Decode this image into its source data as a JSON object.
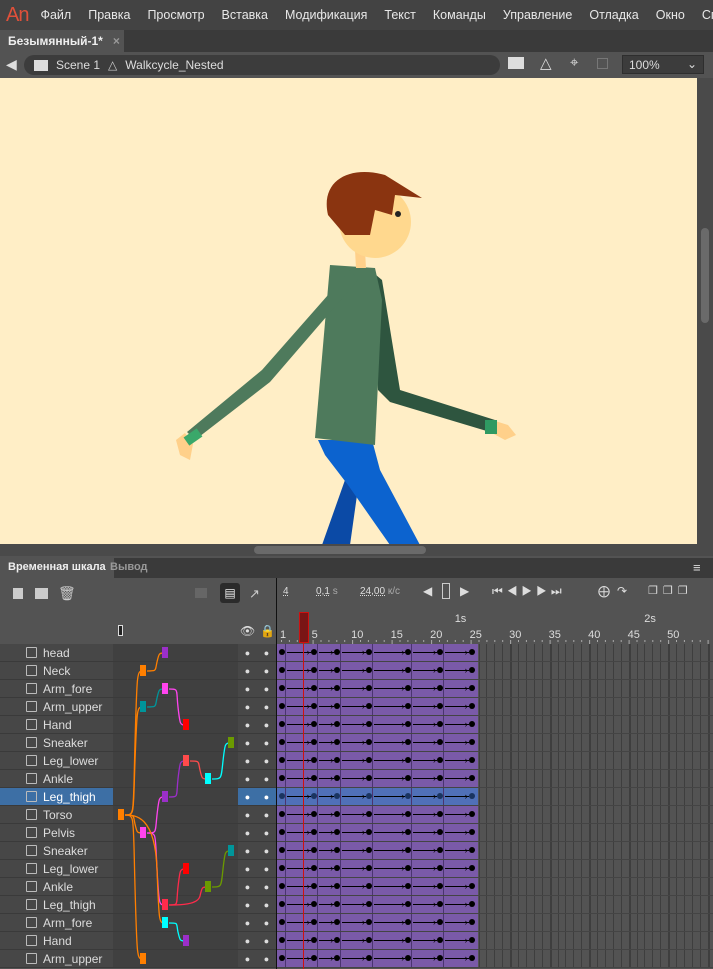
{
  "app": {
    "logo": "An",
    "menu": [
      "Файл",
      "Правка",
      "Просмотр",
      "Вставка",
      "Модификация",
      "Текст",
      "Команды",
      "Управление",
      "Отладка",
      "Окно",
      "Спра"
    ]
  },
  "document": {
    "tab": "Безымянный-1*",
    "close": "×"
  },
  "editbar": {
    "scene": "Scene 1",
    "symbol": "Walkcycle_Nested",
    "zoom": "100%"
  },
  "stage": {
    "background": "#ffeec6"
  },
  "panel": {
    "tabs": [
      "Временная шкала",
      "Вывод"
    ]
  },
  "timeline": {
    "current_frame": "4",
    "elapsed": "0,1",
    "elapsed_unit": "s",
    "fps": "24,00",
    "fps_unit": "к/с",
    "ruler": [
      "1",
      "5",
      "10",
      "15",
      "20",
      "25",
      "30",
      "35",
      "40",
      "45",
      "50"
    ],
    "seconds": [
      "1s",
      "2s"
    ],
    "keyframes": [
      1,
      5,
      8,
      12,
      17,
      21,
      25
    ],
    "span_end": 25,
    "layers": [
      {
        "name": "head",
        "bone": "#9b2fc9"
      },
      {
        "name": "Neck",
        "bone": "#ff7f00"
      },
      {
        "name": "Arm_fore",
        "bone": "#ff44ee"
      },
      {
        "name": "Arm_upper",
        "bone": "#00959a"
      },
      {
        "name": "Hand",
        "bone": "#ff0000"
      },
      {
        "name": "Sneaker",
        "bone": "#6b9a00"
      },
      {
        "name": "Leg_lower",
        "bone": "#ff4b4b"
      },
      {
        "name": "Ankle",
        "bone": "#00ffff"
      },
      {
        "name": "Leg_thigh",
        "bone": "#9b2fc9",
        "selected": true
      },
      {
        "name": "Torso",
        "bone": "#ff7f00"
      },
      {
        "name": "Pelvis",
        "bone": "#ff44ee"
      },
      {
        "name": "Sneaker",
        "bone": "#00959a"
      },
      {
        "name": "Leg_lower",
        "bone": "#ff0000"
      },
      {
        "name": "Ankle",
        "bone": "#6b9a00"
      },
      {
        "name": "Leg_thigh",
        "bone": "#ff2b4b"
      },
      {
        "name": "Arm_fore",
        "bone": "#00ffff"
      },
      {
        "name": "Hand",
        "bone": "#9b2fc9"
      },
      {
        "name": "Arm_upper",
        "bone": "#ff7f00"
      }
    ],
    "span_color": "#7a5aa8",
    "selected_color": "#5070b8"
  }
}
